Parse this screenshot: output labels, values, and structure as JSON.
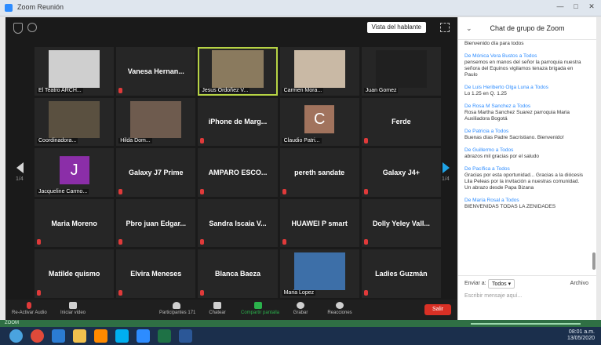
{
  "window": {
    "title": "Zoom Reunión",
    "minimize_glyph": "—",
    "maximize_glyph": "□",
    "close_glyph": "✕"
  },
  "meeting": {
    "view_button": "Vista del hablante",
    "page_left": "1/4",
    "page_right": "1/4",
    "participants": [
      {
        "name": "El Teatro ARCH...",
        "center": "",
        "type": "video",
        "color": "#cfcfcf",
        "muted": true,
        "active": false
      },
      {
        "name": "",
        "center": "Vanesa Hernan...",
        "type": "name",
        "muted": true,
        "active": false
      },
      {
        "name": "Jesus Ordoñez V...",
        "center": "",
        "type": "video",
        "color": "#8a7a5e",
        "muted": false,
        "active": true
      },
      {
        "name": "Carmen Mora...",
        "center": "",
        "type": "video",
        "color": "#c9b9a5",
        "muted": true,
        "active": false
      },
      {
        "name": "Juan Gomez",
        "center": "",
        "type": "video",
        "color": "#202020",
        "muted": true,
        "active": false
      },
      {
        "name": "Coordinadora...",
        "center": "",
        "type": "video",
        "color": "#5a5040",
        "muted": false,
        "active": false
      },
      {
        "name": "Hilda Dom...",
        "center": "",
        "type": "video",
        "color": "#6e5b4e",
        "muted": true,
        "active": false
      },
      {
        "name": "",
        "center": "iPhone de Marg...",
        "type": "name",
        "muted": true,
        "active": false
      },
      {
        "name": "Claudio Patri...",
        "center": "",
        "type": "avatar",
        "letter": "C",
        "color": "#a1735d",
        "muted": true,
        "active": false
      },
      {
        "name": "",
        "center": "Ferde",
        "type": "name",
        "muted": true,
        "active": false
      },
      {
        "name": "Jacqueline Carmo...",
        "center": "",
        "type": "avatar",
        "letter": "J",
        "color": "#8b2ea8",
        "muted": false,
        "active": false
      },
      {
        "name": "",
        "center": "Galaxy J7 Prime",
        "type": "name",
        "muted": true,
        "active": false
      },
      {
        "name": "",
        "center": "AMPARO ESCO...",
        "type": "name",
        "muted": true,
        "active": false
      },
      {
        "name": "",
        "center": "pereth sandate",
        "type": "name",
        "muted": true,
        "active": false
      },
      {
        "name": "",
        "center": "Galaxy J4+",
        "type": "name",
        "muted": true,
        "active": false
      },
      {
        "name": "",
        "center": "Maria Moreno",
        "type": "name",
        "muted": true,
        "active": false
      },
      {
        "name": "",
        "center": "Pbro juan Edgar...",
        "type": "name",
        "muted": true,
        "active": false
      },
      {
        "name": "",
        "center": "Sandra Iscaia V...",
        "type": "name",
        "muted": true,
        "active": false
      },
      {
        "name": "",
        "center": "HUAWEI P smart",
        "type": "name",
        "muted": true,
        "active": false
      },
      {
        "name": "",
        "center": "Dolly Yeley Vall...",
        "type": "name",
        "muted": true,
        "active": false
      },
      {
        "name": "",
        "center": "Matilde quismo",
        "type": "name",
        "muted": true,
        "active": false
      },
      {
        "name": "",
        "center": "Elvira Meneses",
        "type": "name",
        "muted": true,
        "active": false
      },
      {
        "name": "",
        "center": "Blanca Baeza",
        "type": "name",
        "muted": true,
        "active": false
      },
      {
        "name": "Maria Lopez",
        "center": "",
        "type": "video",
        "color": "#3d6fa8",
        "muted": true,
        "active": false
      },
      {
        "name": "",
        "center": "Ladies Guzmán",
        "type": "name",
        "muted": true,
        "active": false
      }
    ]
  },
  "toolbar": {
    "mute": "Re-Activar Audio",
    "video": "Iniciar video",
    "participants": "Participantes",
    "participants_count": "171",
    "chat": "Chatear",
    "share": "Compartir pantalla",
    "record": "Grabar",
    "reactions": "Reacciones",
    "leave": "Salir",
    "share_color": "#2bb24c",
    "leave_color": "#d93025"
  },
  "chat": {
    "title": "Chat de grupo de Zoom",
    "messages": [
      {
        "from": "",
        "text": "Bienvenido día para todos"
      },
      {
        "from": "De Mónica Vera Bustos a Todos",
        "text": "pensemos en manos del señor la parroquia nuestra señora del Equinos vigilamos tenaza brigada en Paulo"
      },
      {
        "from": "De Luis Heriberto Olga Luna a Todos",
        "text": "Lo 1.25 en Q. 1.25"
      },
      {
        "from": "De Rosa M Sanchez a Todos",
        "text": "Rosa Martha Sanchez Suarez parroquia Maria Auxiliadora Bogotá"
      },
      {
        "from": "De Patricia a Todos",
        "text": "Buenas días Padre Sacristiano. Bienvenido!"
      },
      {
        "from": "De Guillermo a Todos",
        "text": "abrazos mil gracias por el saludo"
      },
      {
        "from": "De Pacífica a Todos",
        "text": "Gracias por esta oportunidad... Gracias a la diócesis Lila Peleas por la invitación a nuestras comunidad. Un abrazo desde Papa Bizana"
      },
      {
        "from": "De María Rosal a Todos",
        "text": "BIENVENIDAS TODAS LA ZENIDADES"
      }
    ],
    "send_to_label": "Enviar a:",
    "send_to_value": "Todos ▾",
    "file_label": "Archivo",
    "input_placeholder": "Escribir mensaje aquí..."
  },
  "status_bar": {
    "label": "ZOOM"
  },
  "taskbar": {
    "apps": [
      {
        "icon": "windows-start-icon",
        "color": "#4aa3df"
      },
      {
        "icon": "chrome-icon",
        "color": "#e04a3a"
      },
      {
        "icon": "edge-icon",
        "color": "#2b7cd3"
      },
      {
        "icon": "explorer-icon",
        "color": "#f2c14e"
      },
      {
        "icon": "media-icon",
        "color": "#ff8a00"
      },
      {
        "icon": "skype-icon",
        "color": "#00aff0"
      },
      {
        "icon": "zoom-icon",
        "color": "#2d8cff"
      },
      {
        "icon": "excel-icon",
        "color": "#1e7145"
      },
      {
        "icon": "word-icon",
        "color": "#2b5797"
      }
    ],
    "time": "08:01 a.m.",
    "date": "13/05/2020"
  }
}
